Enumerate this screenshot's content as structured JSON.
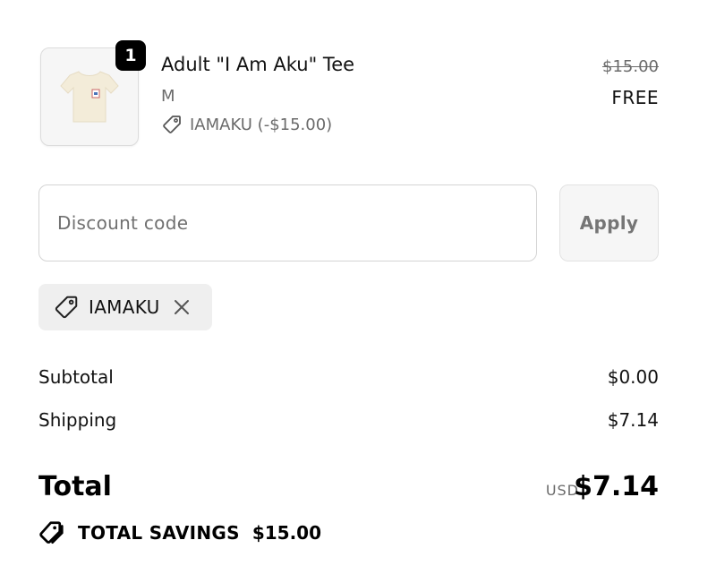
{
  "product": {
    "quantity": "1",
    "name": "Adult \"I Am Aku\" Tee",
    "variant": "M",
    "discount_label": "IAMAKU (-$15.00)",
    "original_price": "$15.00",
    "final_price": "FREE",
    "image_icon": "tshirt-icon"
  },
  "discount": {
    "placeholder": "Discount code",
    "value": "",
    "apply_label": "Apply",
    "applied_code": "IAMAKU",
    "tag_icon": "tag-icon",
    "remove_icon": "close-icon"
  },
  "summary": {
    "subtotal_label": "Subtotal",
    "subtotal_value": "$0.00",
    "shipping_label": "Shipping",
    "shipping_value": "$7.14",
    "total_label": "Total",
    "currency": "USD",
    "total_value": "$7.14",
    "savings_label": "TOTAL SAVINGS",
    "savings_value": "$15.00",
    "savings_icon": "tags-icon"
  }
}
